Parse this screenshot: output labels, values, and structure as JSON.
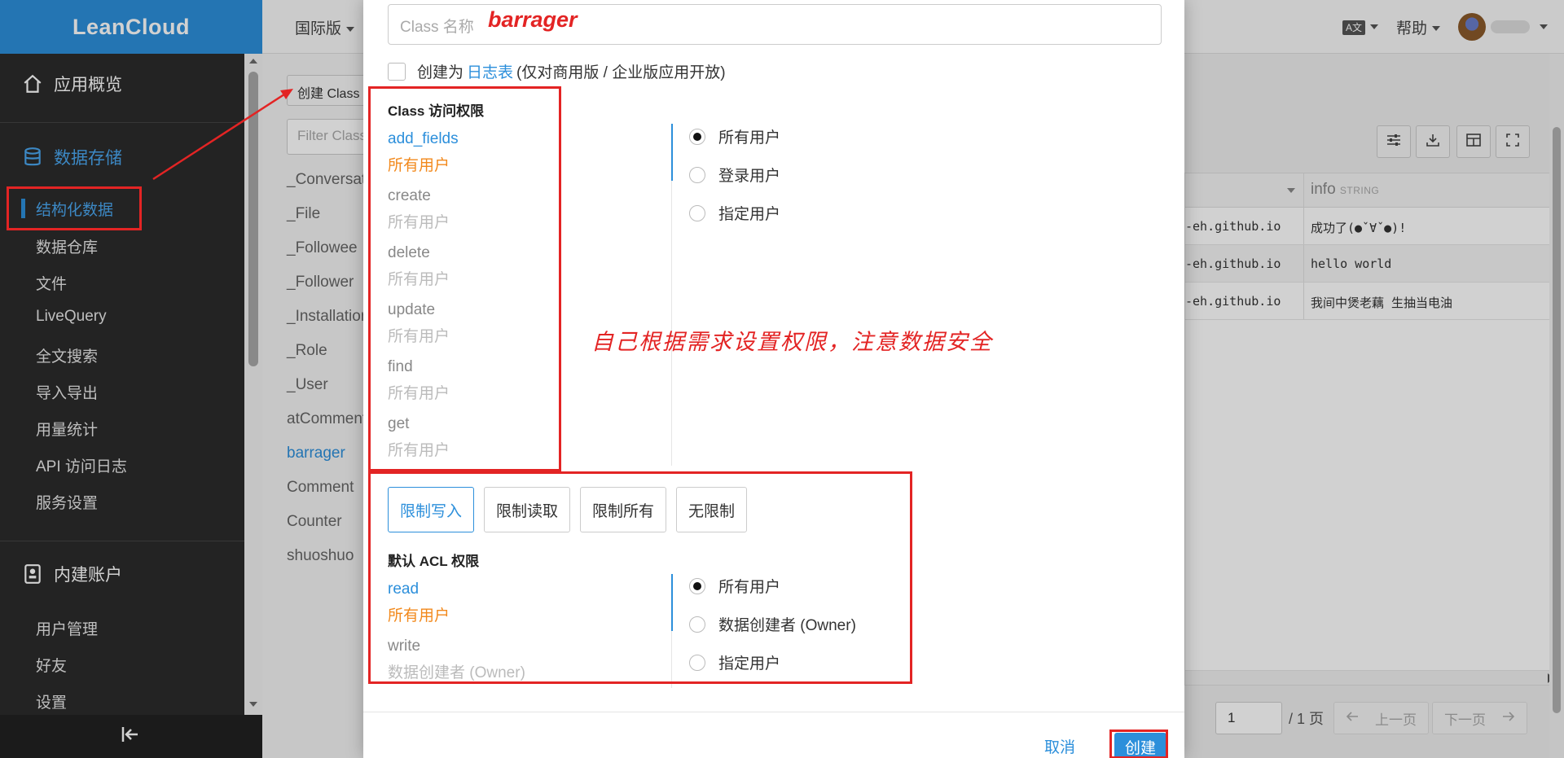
{
  "app": {
    "brand": "LeanCloud",
    "region": "国际版",
    "help": "帮助",
    "lang_badge": "A文"
  },
  "sidebar": {
    "groups": [
      {
        "label": "应用概览",
        "icon": "home-icon"
      },
      {
        "label": "数据存储",
        "icon": "database-icon"
      },
      {
        "label": "内建账户",
        "icon": "id-card-icon"
      }
    ],
    "storage_items": [
      "结构化数据",
      "数据仓库",
      "文件",
      "LiveQuery",
      "全文搜索",
      "导入导出",
      "用量统计",
      "API 访问日志",
      "服务设置"
    ],
    "account_items": [
      "用户管理",
      "好友",
      "设置"
    ]
  },
  "classlist": {
    "create_label": "创建 Class",
    "filter_placeholder": "Filter Class",
    "items": [
      "_Conversation",
      "_File",
      "_Followee",
      "_Follower",
      "_Installation",
      "_Role",
      "_User",
      "atComment",
      "barrager",
      "Comment",
      "Counter",
      "shuoshuo"
    ],
    "selected": "barrager"
  },
  "grid": {
    "column": {
      "name": "info",
      "type": "STRING"
    },
    "rows": [
      {
        "a": "-eh.github.io",
        "b": "成功了(●ˇ∀ˇ●)!"
      },
      {
        "a": "-eh.github.io",
        "b": "hello world"
      },
      {
        "a": "-eh.github.io",
        "b": "我间中煲老藕 生抽当电油"
      }
    ],
    "pager": {
      "page": "1",
      "total": "/ 1 页",
      "prev": "上一页",
      "next": "下一页"
    }
  },
  "modal": {
    "name_placeholder": "Class 名称",
    "name_value": "barrager",
    "log_checkbox": {
      "prefix": "创建为",
      "link": "日志表",
      "suffix": "(仅对商用版 / 企业版应用开放)"
    },
    "class_acl_title": "Class 访问权限",
    "class_perms": [
      {
        "name": "add_fields",
        "value": "所有用户"
      },
      {
        "name": "create",
        "value": "所有用户"
      },
      {
        "name": "delete",
        "value": "所有用户"
      },
      {
        "name": "update",
        "value": "所有用户"
      },
      {
        "name": "find",
        "value": "所有用户"
      },
      {
        "name": "get",
        "value": "所有用户"
      }
    ],
    "class_radio": [
      "所有用户",
      "登录用户",
      "指定用户"
    ],
    "presets": [
      "限制写入",
      "限制读取",
      "限制所有",
      "无限制"
    ],
    "default_acl_title": "默认 ACL 权限",
    "acl_perms": [
      {
        "name": "read",
        "value": "所有用户"
      },
      {
        "name": "write",
        "value": "数据创建者 (Owner)"
      }
    ],
    "acl_radio": [
      "所有用户",
      "数据创建者 (Owner)",
      "指定用户"
    ],
    "cancel": "取消",
    "create": "创建"
  },
  "annotation": {
    "note": "自己根据需求设置权限，注意数据安全",
    "color": "#e32424"
  },
  "colors": {
    "primary": "#2c8fdb",
    "sidebar_bg": "#2b2b2b",
    "orange": "#f2891c"
  }
}
